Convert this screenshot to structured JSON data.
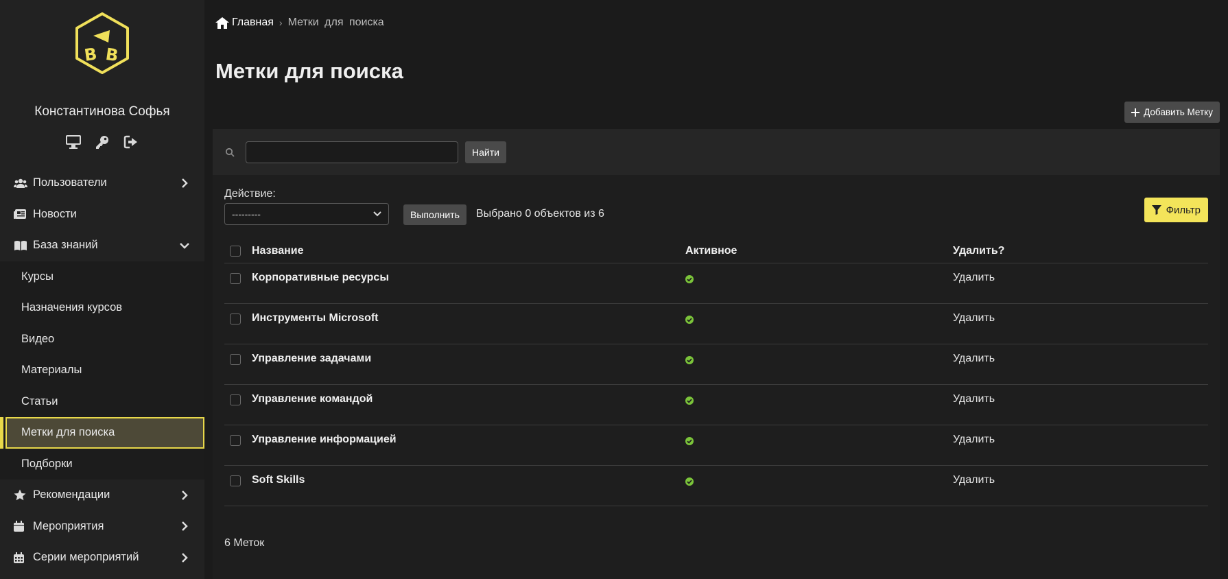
{
  "sidebar": {
    "user_name": "Константинова Софья",
    "nav": [
      {
        "label": "Пользователи",
        "icon": "users-icon",
        "chevron": "right"
      },
      {
        "label": "Новости",
        "icon": "newspaper-icon",
        "chevron": "none"
      },
      {
        "label": "База знаний",
        "icon": "book-icon",
        "chevron": "down"
      }
    ],
    "subnav": [
      {
        "label": "Курсы"
      },
      {
        "label": "Назначения курсов"
      },
      {
        "label": "Видео"
      },
      {
        "label": "Материалы"
      },
      {
        "label": "Статьи"
      },
      {
        "label": "Метки для поиска",
        "active": true
      },
      {
        "label": "Подборки"
      }
    ],
    "nav_bottom": [
      {
        "label": "Рекомендации",
        "icon": "star-icon",
        "chevron": "right"
      },
      {
        "label": "Мероприятия",
        "icon": "calendar-icon",
        "chevron": "right"
      },
      {
        "label": "Серии мероприятий",
        "icon": "calendar-grid-icon",
        "chevron": "right"
      }
    ]
  },
  "breadcrumb": {
    "home": "Главная",
    "separator": "›",
    "current": "Метки для поиска"
  },
  "page_title": "Метки для поиска",
  "add_button": "Добавить Метку",
  "search": {
    "value": "",
    "placeholder": "",
    "button": "Найти"
  },
  "action": {
    "label": "Действие:",
    "selected": "---------",
    "run_button": "Выполнить",
    "selected_count": "Выбрано 0 объектов из 6"
  },
  "filter_button": "Фильтр",
  "table": {
    "headers": {
      "name": "Название",
      "active": "Активное",
      "delete": "Удалить?"
    },
    "rows": [
      {
        "name": "Корпоративные ресурсы",
        "active": true,
        "delete": "Удалить"
      },
      {
        "name": "Инструменты Microsoft",
        "active": true,
        "delete": "Удалить"
      },
      {
        "name": "Управление задачами",
        "active": true,
        "delete": "Удалить"
      },
      {
        "name": "Управление командой",
        "active": true,
        "delete": "Удалить"
      },
      {
        "name": "Управление информацией",
        "active": true,
        "delete": "Удалить"
      },
      {
        "name": "Soft Skills",
        "active": true,
        "delete": "Удалить"
      }
    ]
  },
  "footer_count": "6 Меток",
  "colors": {
    "accent": "#f3e45a",
    "active_check": "#7bc43a",
    "logo": "#f0e05a"
  }
}
